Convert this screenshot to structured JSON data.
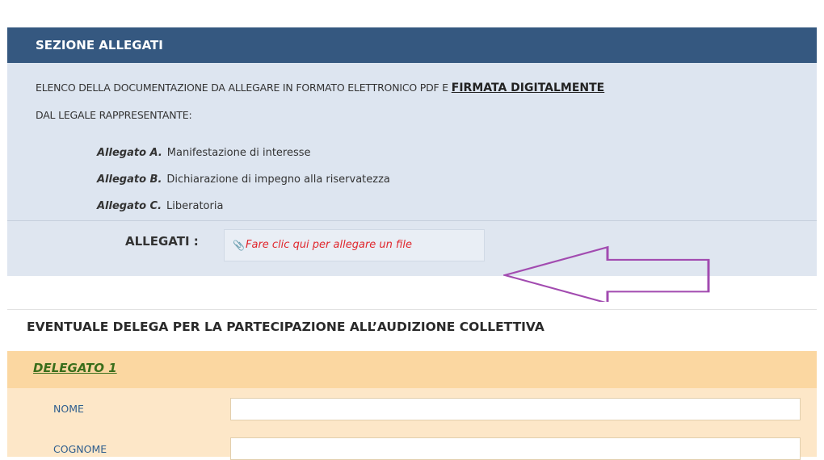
{
  "section": {
    "title": "SEZIONE ALLEGATI",
    "intro_part1": "ELENCO DELLA DOCUMENTAZIONE DA ALLEGARE IN FORMATO ELETTRONICO PDF E ",
    "intro_highlight": "FIRMATA DIGITALMENTE",
    "intro_part2": "DAL LEGALE RAPPRESENTANTE:",
    "attachments": [
      {
        "key": "Allegato A.",
        "text": "Manifestazione di interesse"
      },
      {
        "key": "Allegato B.",
        "text": "Dichiarazione di impegno alla riservatezza"
      },
      {
        "key": "Allegato C.",
        "text": "Liberatoria"
      }
    ],
    "upload_label": "ALLEGATI :",
    "upload_placeholder": "Fare clic qui per allegare un file",
    "clip_icon": "paperclip-icon",
    "arrow_color": "#a24bb0"
  },
  "delegation": {
    "title": "EVENTUALE DELEGA PER LA PARTECIPAZIONE ALL’AUDIZIONE COLLETTIVA",
    "delegate_header": "DELEGATO 1",
    "fields": [
      {
        "label": "NOME",
        "value": ""
      },
      {
        "label": "COGNOME",
        "value": ""
      }
    ]
  }
}
